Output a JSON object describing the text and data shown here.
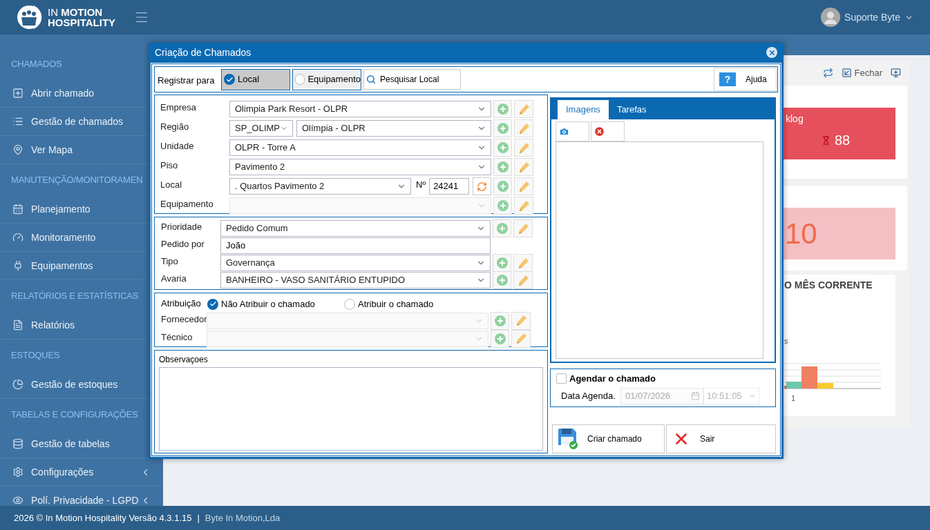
{
  "header": {
    "logo_top": "IN **MOTION**",
    "logo_bottom": "HOSPITALITY",
    "user": "Suporte Byte"
  },
  "sidebar": {
    "sections": [
      {
        "title": "CHAMADOS",
        "items": [
          {
            "label": "Abrir chamado",
            "chevron": false
          },
          {
            "label": "Gestão de chamados",
            "chevron": false
          },
          {
            "label": "Ver Mapa",
            "chevron": false
          }
        ]
      },
      {
        "title": "MANUTENÇÃO/MONITORAMEN",
        "items": [
          {
            "label": "Planejamento",
            "chevron": false
          },
          {
            "label": "Monitoramento",
            "chevron": false
          },
          {
            "label": "Equipamentos",
            "chevron": false
          }
        ]
      },
      {
        "title": "RELATÓRIOS E ESTATÍSTICAS",
        "items": [
          {
            "label": "Relatórios",
            "chevron": false
          }
        ]
      },
      {
        "title": "ESTOQUES",
        "items": [
          {
            "label": "Gestão de estoques",
            "chevron": false
          }
        ]
      },
      {
        "title": "TABELAS E CONFIGURAÇÕES",
        "items": [
          {
            "label": "Gestão de tabelas",
            "chevron": false
          },
          {
            "label": "Configurações",
            "chevron": true
          },
          {
            "label": "Polí. Privacidade - LGPD",
            "chevron": true
          }
        ]
      }
    ]
  },
  "dashboard": {
    "close_label": "Fechar",
    "backlog_title": "klog",
    "backlog_value": "88",
    "second_value": "10",
    "chart_title": "O MÊS CORRENTE",
    "chart_legend": "s",
    "chart_x_label": "1"
  },
  "modal": {
    "title": "Criação de Chamados",
    "registrar": {
      "label": "Registrar para",
      "options": [
        {
          "label": "Local",
          "selected": true
        },
        {
          "label": "Equipamento",
          "selected": false
        }
      ],
      "search": "Pesquisar Local",
      "help_icon": "?",
      "help": "Ajuda"
    },
    "location": {
      "rows": [
        {
          "label": "Empresa",
          "kind": "select",
          "value": "Olimpia Park Resort - OLPR",
          "disabled": false
        },
        {
          "label": "Região",
          "kind": "pair",
          "values": [
            "SP_OLIMP",
            "Olímpia - OLPR"
          ],
          "disabled": false
        },
        {
          "label": "Unidade",
          "kind": "select",
          "value": "OLPR - Torre A",
          "disabled": false
        },
        {
          "label": "Piso",
          "kind": "select",
          "value": "Pavimento 2",
          "disabled": false
        },
        {
          "label": "Local",
          "kind": "numbered",
          "value": ". Quartos Pavimento 2",
          "number_label": "Nº",
          "number": "24241",
          "disabled": false
        },
        {
          "label": "Equipamento",
          "kind": "select",
          "disabled": true
        }
      ]
    },
    "request": {
      "rows": [
        {
          "label": "Prioridade",
          "kind": "select",
          "value": "Pedido Comum",
          "disabled": false
        },
        {
          "label": "Pedido por",
          "kind": "text",
          "value": "João",
          "disabled": false
        },
        {
          "label": "Tipo",
          "kind": "select",
          "value": "Governança",
          "disabled": false
        },
        {
          "label": "Avaria",
          "kind": "select",
          "value": "BANHEIRO - VASO SANITÁRIO ENTUPIDO",
          "disabled": false
        }
      ]
    },
    "assignment": {
      "label": "Atribuição",
      "options": [
        {
          "label": "Não Atribuir o chamado",
          "selected": true
        },
        {
          "label": "Atribuir o chamado",
          "selected": false
        }
      ],
      "rows": [
        {
          "label": "Fornecedor",
          "kind": "select",
          "disabled": true
        },
        {
          "label": "Técnico",
          "kind": "select",
          "disabled": true
        }
      ]
    },
    "notes": {
      "label": "Observaçoes"
    },
    "tabs": [
      {
        "label": "Imagens",
        "selected": true
      },
      {
        "label": "Tarefas",
        "selected": false
      }
    ],
    "schedule": {
      "label": "Agendar o chamado",
      "checked": false,
      "date_label": "Data Agenda.",
      "date": "01/07/2026",
      "time": "10:51:05",
      "disabled": true
    },
    "actions": [
      {
        "label": "Criar chamado",
        "kind": "save"
      },
      {
        "label": "Sair",
        "kind": "exit"
      }
    ]
  },
  "footer": {
    "copyright": "2026 © In Motion Hospitality Versão 4.3.1.15",
    "separator": "|",
    "company": "Byte In Motion,Lda"
  }
}
